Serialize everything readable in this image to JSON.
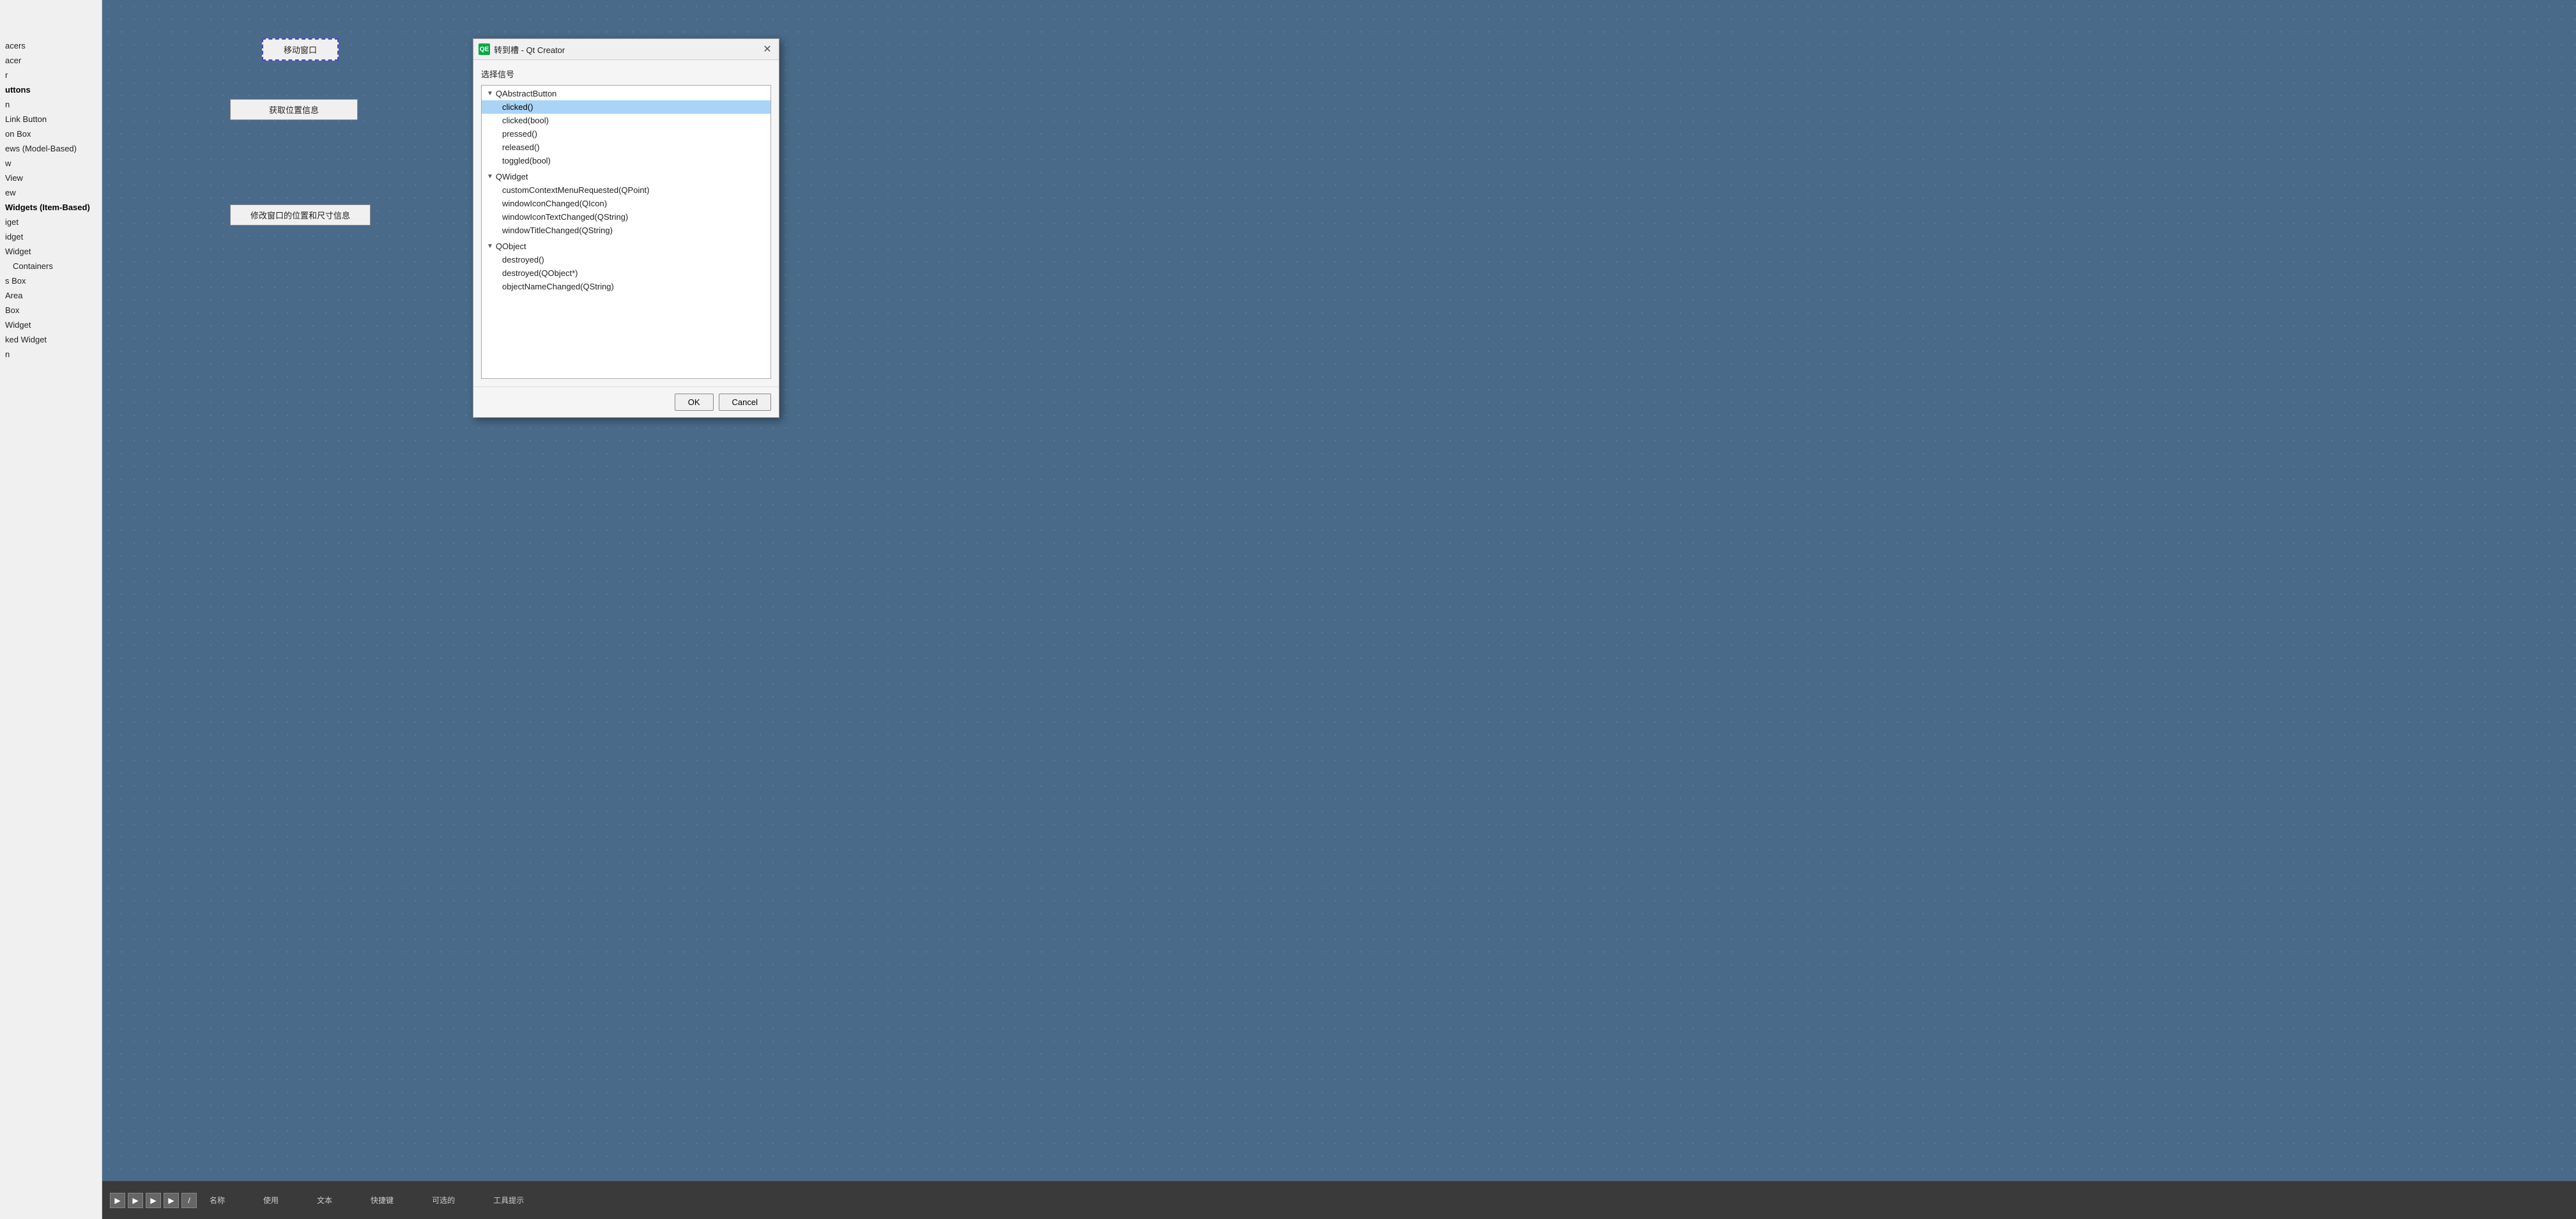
{
  "sidebar": {
    "items": [
      {
        "label": "acers",
        "indent": false,
        "bold": false
      },
      {
        "label": "acer",
        "indent": false,
        "bold": false
      },
      {
        "label": "r",
        "indent": false,
        "bold": false
      },
      {
        "label": "uttons",
        "indent": false,
        "bold": true
      },
      {
        "label": "",
        "indent": false,
        "bold": false
      },
      {
        "label": "",
        "indent": false,
        "bold": false
      },
      {
        "label": "n",
        "indent": false,
        "bold": false
      },
      {
        "label": "",
        "indent": false,
        "bold": false
      },
      {
        "label": "Link Button",
        "indent": false,
        "bold": false
      },
      {
        "label": "on Box",
        "indent": false,
        "bold": false
      },
      {
        "label": "ews (Model-Based)",
        "indent": false,
        "bold": false
      },
      {
        "label": "",
        "indent": false,
        "bold": false
      },
      {
        "label": "w",
        "indent": false,
        "bold": false
      },
      {
        "label": "View",
        "indent": false,
        "bold": false
      },
      {
        "label": "ew",
        "indent": false,
        "bold": false
      },
      {
        "label": "Widgets (Item-Based)",
        "indent": false,
        "bold": true
      },
      {
        "label": "iget",
        "indent": false,
        "bold": false
      },
      {
        "label": "idget",
        "indent": false,
        "bold": false
      },
      {
        "label": "Widget",
        "indent": false,
        "bold": false
      },
      {
        "label": "Containers",
        "indent": true,
        "bold": false
      },
      {
        "label": "s Box",
        "indent": false,
        "bold": false
      },
      {
        "label": "Area",
        "indent": false,
        "bold": false
      },
      {
        "label": "Box",
        "indent": false,
        "bold": false
      },
      {
        "label": "Widget",
        "indent": false,
        "bold": false
      },
      {
        "label": "ked Widget",
        "indent": false,
        "bold": false
      },
      {
        "label": "n",
        "indent": false,
        "bold": false
      }
    ]
  },
  "canvas": {
    "btn_move_window": "移动窗口",
    "btn_get_pos": "获取位置信息",
    "btn_modify_window": "修改窗口的位置和尺寸信息"
  },
  "dialog": {
    "title": "转到槽 - Qt Creator",
    "icon_label": "QE",
    "section_label": "选择信号",
    "tree": {
      "groups": [
        {
          "name": "QAbstractButton",
          "items": [
            {
              "label": "clicked()",
              "selected": true
            },
            {
              "label": "clicked(bool)",
              "selected": false
            },
            {
              "label": "pressed()",
              "selected": false
            },
            {
              "label": "released()",
              "selected": false
            },
            {
              "label": "toggled(bool)",
              "selected": false
            }
          ]
        },
        {
          "name": "QWidget",
          "items": [
            {
              "label": "customContextMenuRequested(QPoint)",
              "selected": false
            },
            {
              "label": "windowIconChanged(QIcon)",
              "selected": false
            },
            {
              "label": "windowIconTextChanged(QString)",
              "selected": false
            },
            {
              "label": "windowTitleChanged(QString)",
              "selected": false
            }
          ]
        },
        {
          "name": "QObject",
          "items": [
            {
              "label": "destroyed()",
              "selected": false
            },
            {
              "label": "destroyed(QObject*)",
              "selected": false
            },
            {
              "label": "objectNameChanged(QString)",
              "selected": false
            }
          ]
        }
      ]
    },
    "ok_label": "OK",
    "cancel_label": "Cancel"
  },
  "bottom": {
    "columns": [
      "名称",
      "使用",
      "文本",
      "快捷键",
      "可选的",
      "工具提示"
    ]
  }
}
